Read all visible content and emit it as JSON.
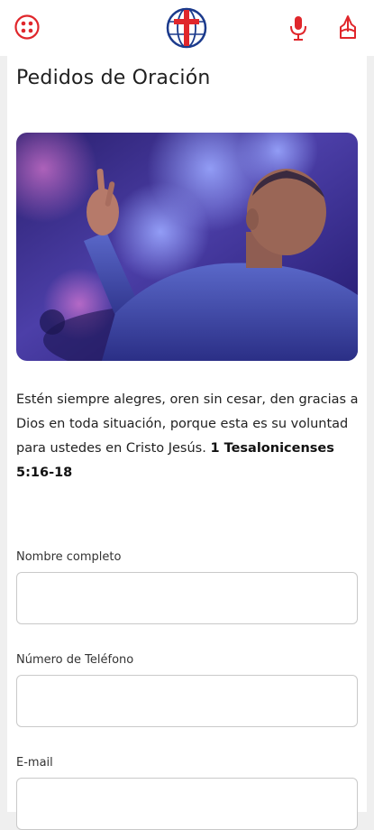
{
  "header": {
    "menu_icon": "grid-menu-icon",
    "logo": "cross-globe-logo",
    "mic_icon": "microphone-icon",
    "prayer_icon": "praying-hands-icon",
    "accent_color": "#e0262b"
  },
  "page": {
    "title": "Pedidos de Oración"
  },
  "verse": {
    "text": "Estén siempre alegres, oren sin cesar, den gracias a Dios en toda situación, porque esta es su voluntad para ustedes en Cristo Jesús.",
    "reference": "1 Tesalonicenses 5:16-18"
  },
  "form": {
    "name_label": "Nombre completo",
    "name_value": "",
    "phone_label": "Número de Teléfono",
    "phone_value": "",
    "email_label": "E-mail",
    "email_value": ""
  }
}
